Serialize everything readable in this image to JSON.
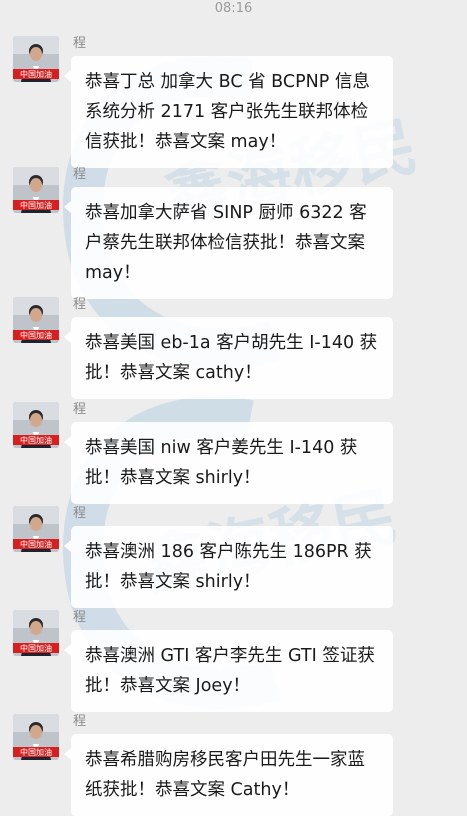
{
  "status_time": "08:16",
  "watermark_text": "鑫海移民",
  "avatar_badge": "中国加油",
  "messages": [
    {
      "sender": "程",
      "text": "恭喜丁总 加拿大 BC 省 BCPNP 信息系统分析 2171 客户张先生联邦体检信获批！恭喜文案 may！"
    },
    {
      "sender": "程",
      "text": "恭喜加拿大萨省 SINP 厨师 6322 客户蔡先生联邦体检信获批！恭喜文案 may！"
    },
    {
      "sender": "程",
      "text": "恭喜美国 eb-1a 客户胡先生 I-140 获批！恭喜文案 cathy！"
    },
    {
      "sender": "程",
      "text": "恭喜美国 niw 客户姜先生 I-140 获批！恭喜文案 shirly！"
    },
    {
      "sender": "程",
      "text": "恭喜澳洲 186 客户陈先生 186PR 获批！恭喜文案 shirly！"
    },
    {
      "sender": "程",
      "text": "恭喜澳洲 GTI 客户李先生 GTI 签证获批！恭喜文案 Joey！"
    },
    {
      "sender": "程",
      "text": "恭喜希腊购房移民客户田先生一家蓝纸获批！恭喜文案 Cathy！"
    }
  ]
}
